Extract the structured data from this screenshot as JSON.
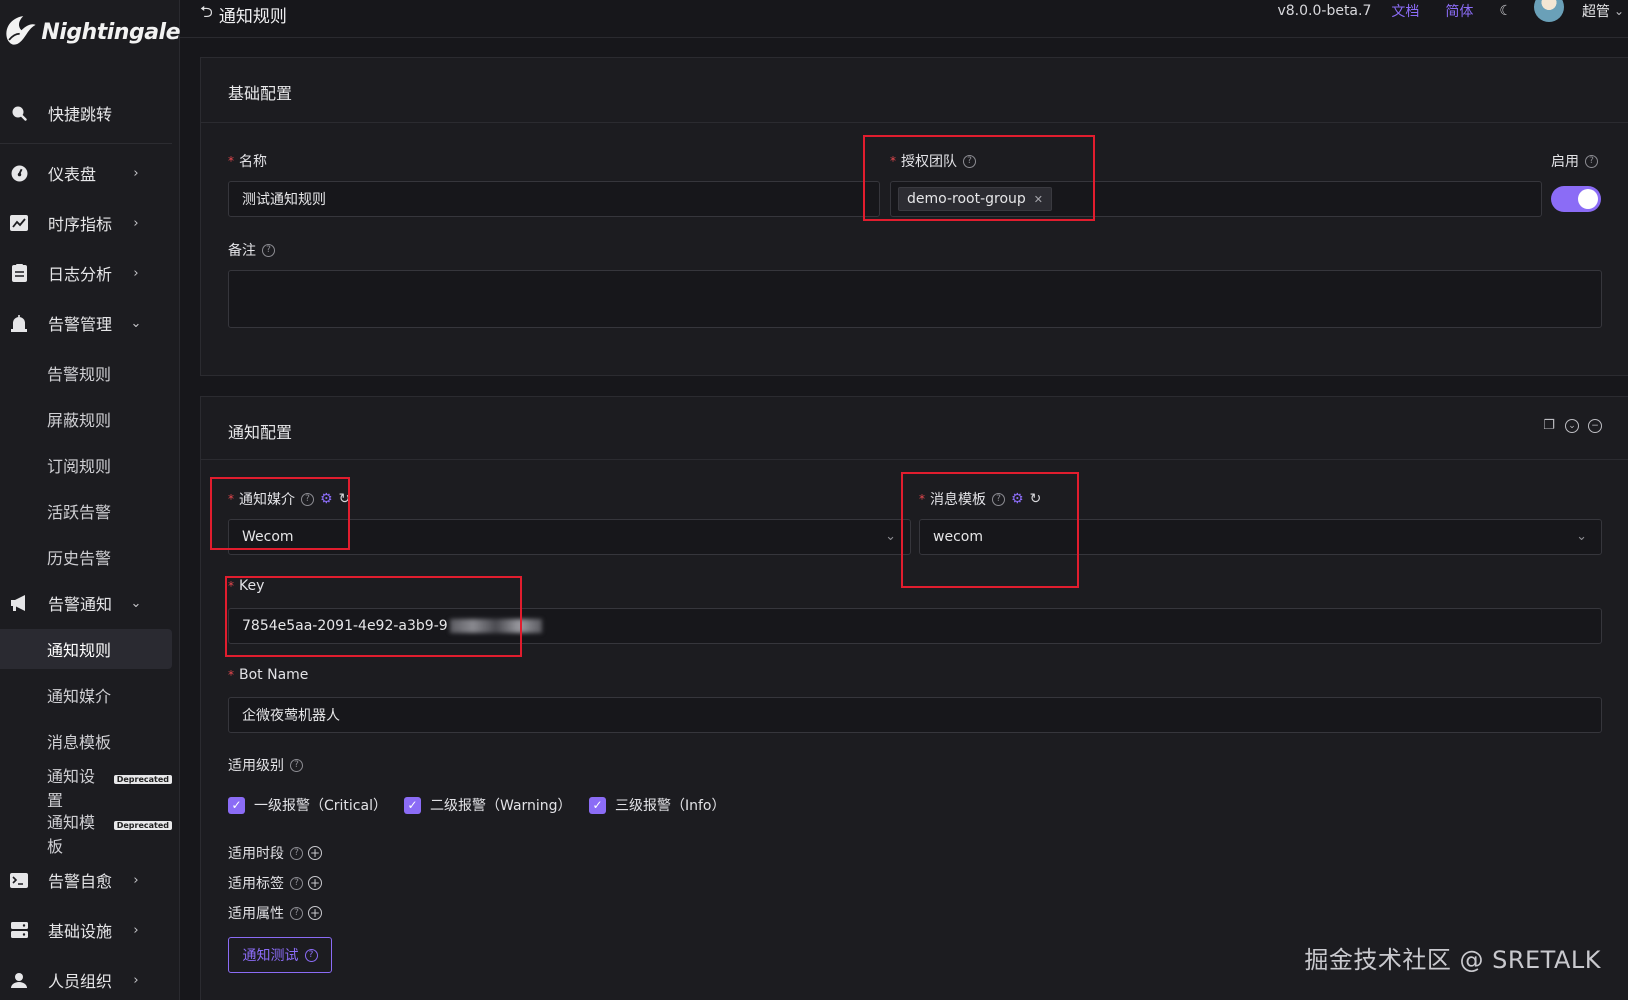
{
  "app": {
    "logo_text": "Nightingale"
  },
  "sidebar": {
    "search_label": "快捷跳转",
    "groups": [
      {
        "label": "仪表盘"
      },
      {
        "label": "时序指标"
      },
      {
        "label": "日志分析"
      },
      {
        "label": "告警管理"
      },
      {
        "label": "告警通知"
      },
      {
        "label": "告警自愈"
      },
      {
        "label": "基础设施"
      },
      {
        "label": "人员组织"
      }
    ],
    "alert_mgmt_items": [
      "告警规则",
      "屏蔽规则",
      "订阅规则",
      "活跃告警",
      "历史告警"
    ],
    "notify_items": [
      {
        "label": "通知规则"
      },
      {
        "label": "通知媒介"
      },
      {
        "label": "消息模板"
      },
      {
        "label": "通知设置",
        "badge": "Deprecated"
      },
      {
        "label": "通知模板",
        "badge": "Deprecated"
      }
    ]
  },
  "topbar": {
    "title": "通知规则",
    "version": "v8.0.0-beta.7",
    "docs_link": "文档",
    "lang_link": "简体",
    "user": "超管"
  },
  "basic": {
    "section_title": "基础配置",
    "name_label": "名称",
    "name_value": "测试通知规则",
    "team_label": "授权团队",
    "team_tag": "demo-root-group",
    "enable_label": "启用",
    "remark_label": "备注"
  },
  "notify": {
    "section_title": "通知配置",
    "media_label": "通知媒介",
    "media_value": "Wecom",
    "template_label": "消息模板",
    "template_value": "wecom",
    "key_label": "Key",
    "key_value": "7854e5aa-2091-4e92-a3b9-9",
    "bot_label": "Bot Name",
    "bot_value": "企微夜莺机器人",
    "levels_label": "适用级别",
    "levels": [
      "一级报警（Critical）",
      "二级报警（Warning）",
      "三级报警（Info）"
    ],
    "period_label": "适用时段",
    "tags_label": "适用标签",
    "attrs_label": "适用属性",
    "test_button": "通知测试"
  },
  "watermark": "掘金技术社区 @ SRETALK",
  "colors": {
    "accent": "#8b6cf6",
    "highlight_box": "#e11d2e",
    "background": "#17171b"
  }
}
